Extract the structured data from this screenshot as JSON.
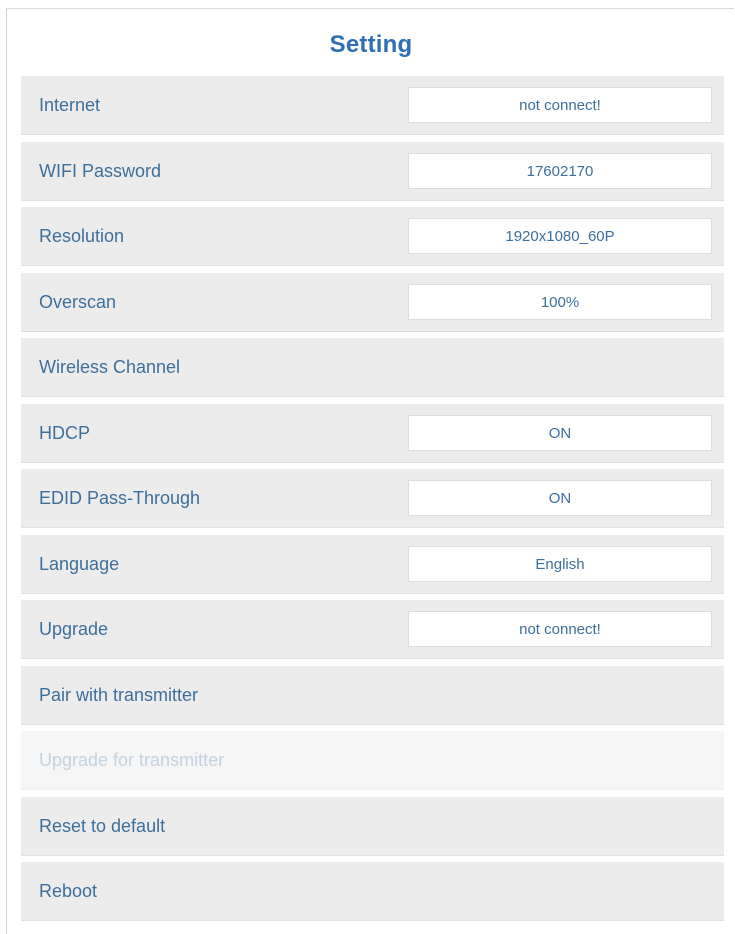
{
  "page": {
    "title": "Setting"
  },
  "rows": [
    {
      "label": "Internet",
      "value": "not connect!"
    },
    {
      "label": "WIFI Password",
      "value": "17602170"
    },
    {
      "label": "Resolution",
      "value": "1920x1080_60P"
    },
    {
      "label": "Overscan",
      "value": "100%"
    },
    {
      "label": "Wireless Channel"
    },
    {
      "label": "HDCP",
      "value": "ON"
    },
    {
      "label": "EDID Pass-Through",
      "value": "ON"
    },
    {
      "label": "Language",
      "value": "English"
    },
    {
      "label": "Upgrade",
      "value": "not connect!"
    },
    {
      "label": "Pair with transmitter"
    },
    {
      "label": "Upgrade for transmitter"
    },
    {
      "label": "Reset to default"
    },
    {
      "label": "Reboot"
    }
  ],
  "colors": {
    "title": "#2f6fb3",
    "text": "#3d6f9c",
    "disabled_text": "#c4d3e0",
    "row_bg": "#ececec",
    "value_bg": "#ffffff"
  }
}
